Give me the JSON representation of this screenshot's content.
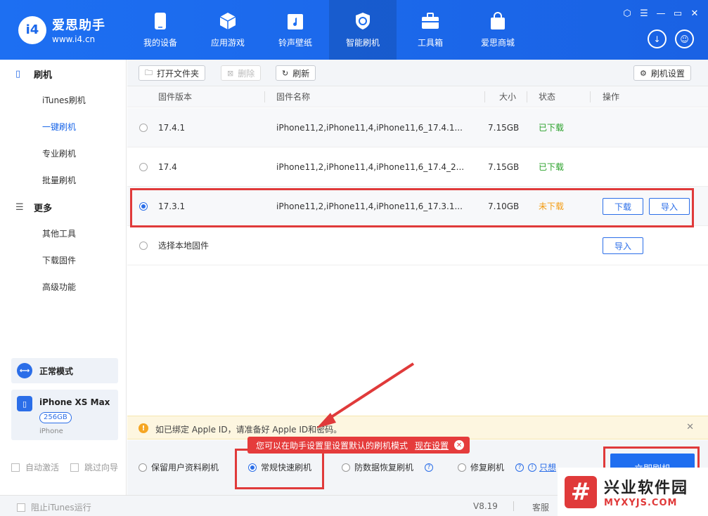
{
  "app": {
    "logo_badge": "i4",
    "name": "爱思助手",
    "url": "www.i4.cn"
  },
  "nav": [
    {
      "label": "我的设备",
      "icon": "phone-icon"
    },
    {
      "label": "应用游戏",
      "icon": "cube-icon"
    },
    {
      "label": "铃声壁纸",
      "icon": "music-folder-icon"
    },
    {
      "label": "智能刷机",
      "icon": "refresh-shield-icon",
      "active": true
    },
    {
      "label": "工具箱",
      "icon": "toolbox-icon"
    },
    {
      "label": "爱思商城",
      "icon": "shopping-bag-icon"
    }
  ],
  "sidebar": {
    "group1": "刷机",
    "items1": [
      "iTunes刷机",
      "一键刷机",
      "专业刷机",
      "批量刷机"
    ],
    "group2": "更多",
    "items2": [
      "其他工具",
      "下载固件",
      "高级功能"
    ],
    "mode": "正常模式",
    "device_name": "iPhone XS Max",
    "device_capacity": "256GB",
    "device_type": "iPhone",
    "auto_activate": "自动激活",
    "skip_guide": "跳过向导"
  },
  "toolbar": {
    "open_folder": "打开文件夹",
    "delete": "删除",
    "refresh": "刷新",
    "flash_settings": "刷机设置"
  },
  "table": {
    "headers": [
      "固件版本",
      "固件名称",
      "大小",
      "状态",
      "操作"
    ],
    "rows": [
      {
        "version": "17.4.1",
        "name": "iPhone11,2,iPhone11,4,iPhone11,6_17.4.1...",
        "size": "7.15GB",
        "status": "已下载"
      },
      {
        "version": "17.4",
        "name": "iPhone11,2,iPhone11,4,iPhone11,6_17.4_2...",
        "size": "7.15GB",
        "status": "已下载"
      },
      {
        "version": "17.3.1",
        "name": "iPhone11,2,iPhone11,4,iPhone11,6_17.3.1...",
        "size": "7.10GB",
        "status": "未下载",
        "btn_download": "下载",
        "btn_import": "导入"
      }
    ],
    "local_label": "选择本地固件",
    "local_import": "导入"
  },
  "notice": "如已绑定 Apple ID，请准备好 Apple ID和密码。",
  "options": {
    "keep_data": "保留用户资料刷机",
    "quick": "常规快速刷机",
    "anti_recovery": "防数据恢复刷机",
    "repair": "修复刷机",
    "only_partial": "只想"
  },
  "tooltip": {
    "text": "您可以在助手设置里设置默认的刷机模式",
    "link": "现在设置"
  },
  "flash_button": "立即刷机",
  "footer": {
    "block_itunes": "阻止iTunes运行",
    "version": "V8.19",
    "service": "客服"
  },
  "watermark": {
    "cn": "兴业软件园",
    "en": "MYXYJS.COM"
  }
}
